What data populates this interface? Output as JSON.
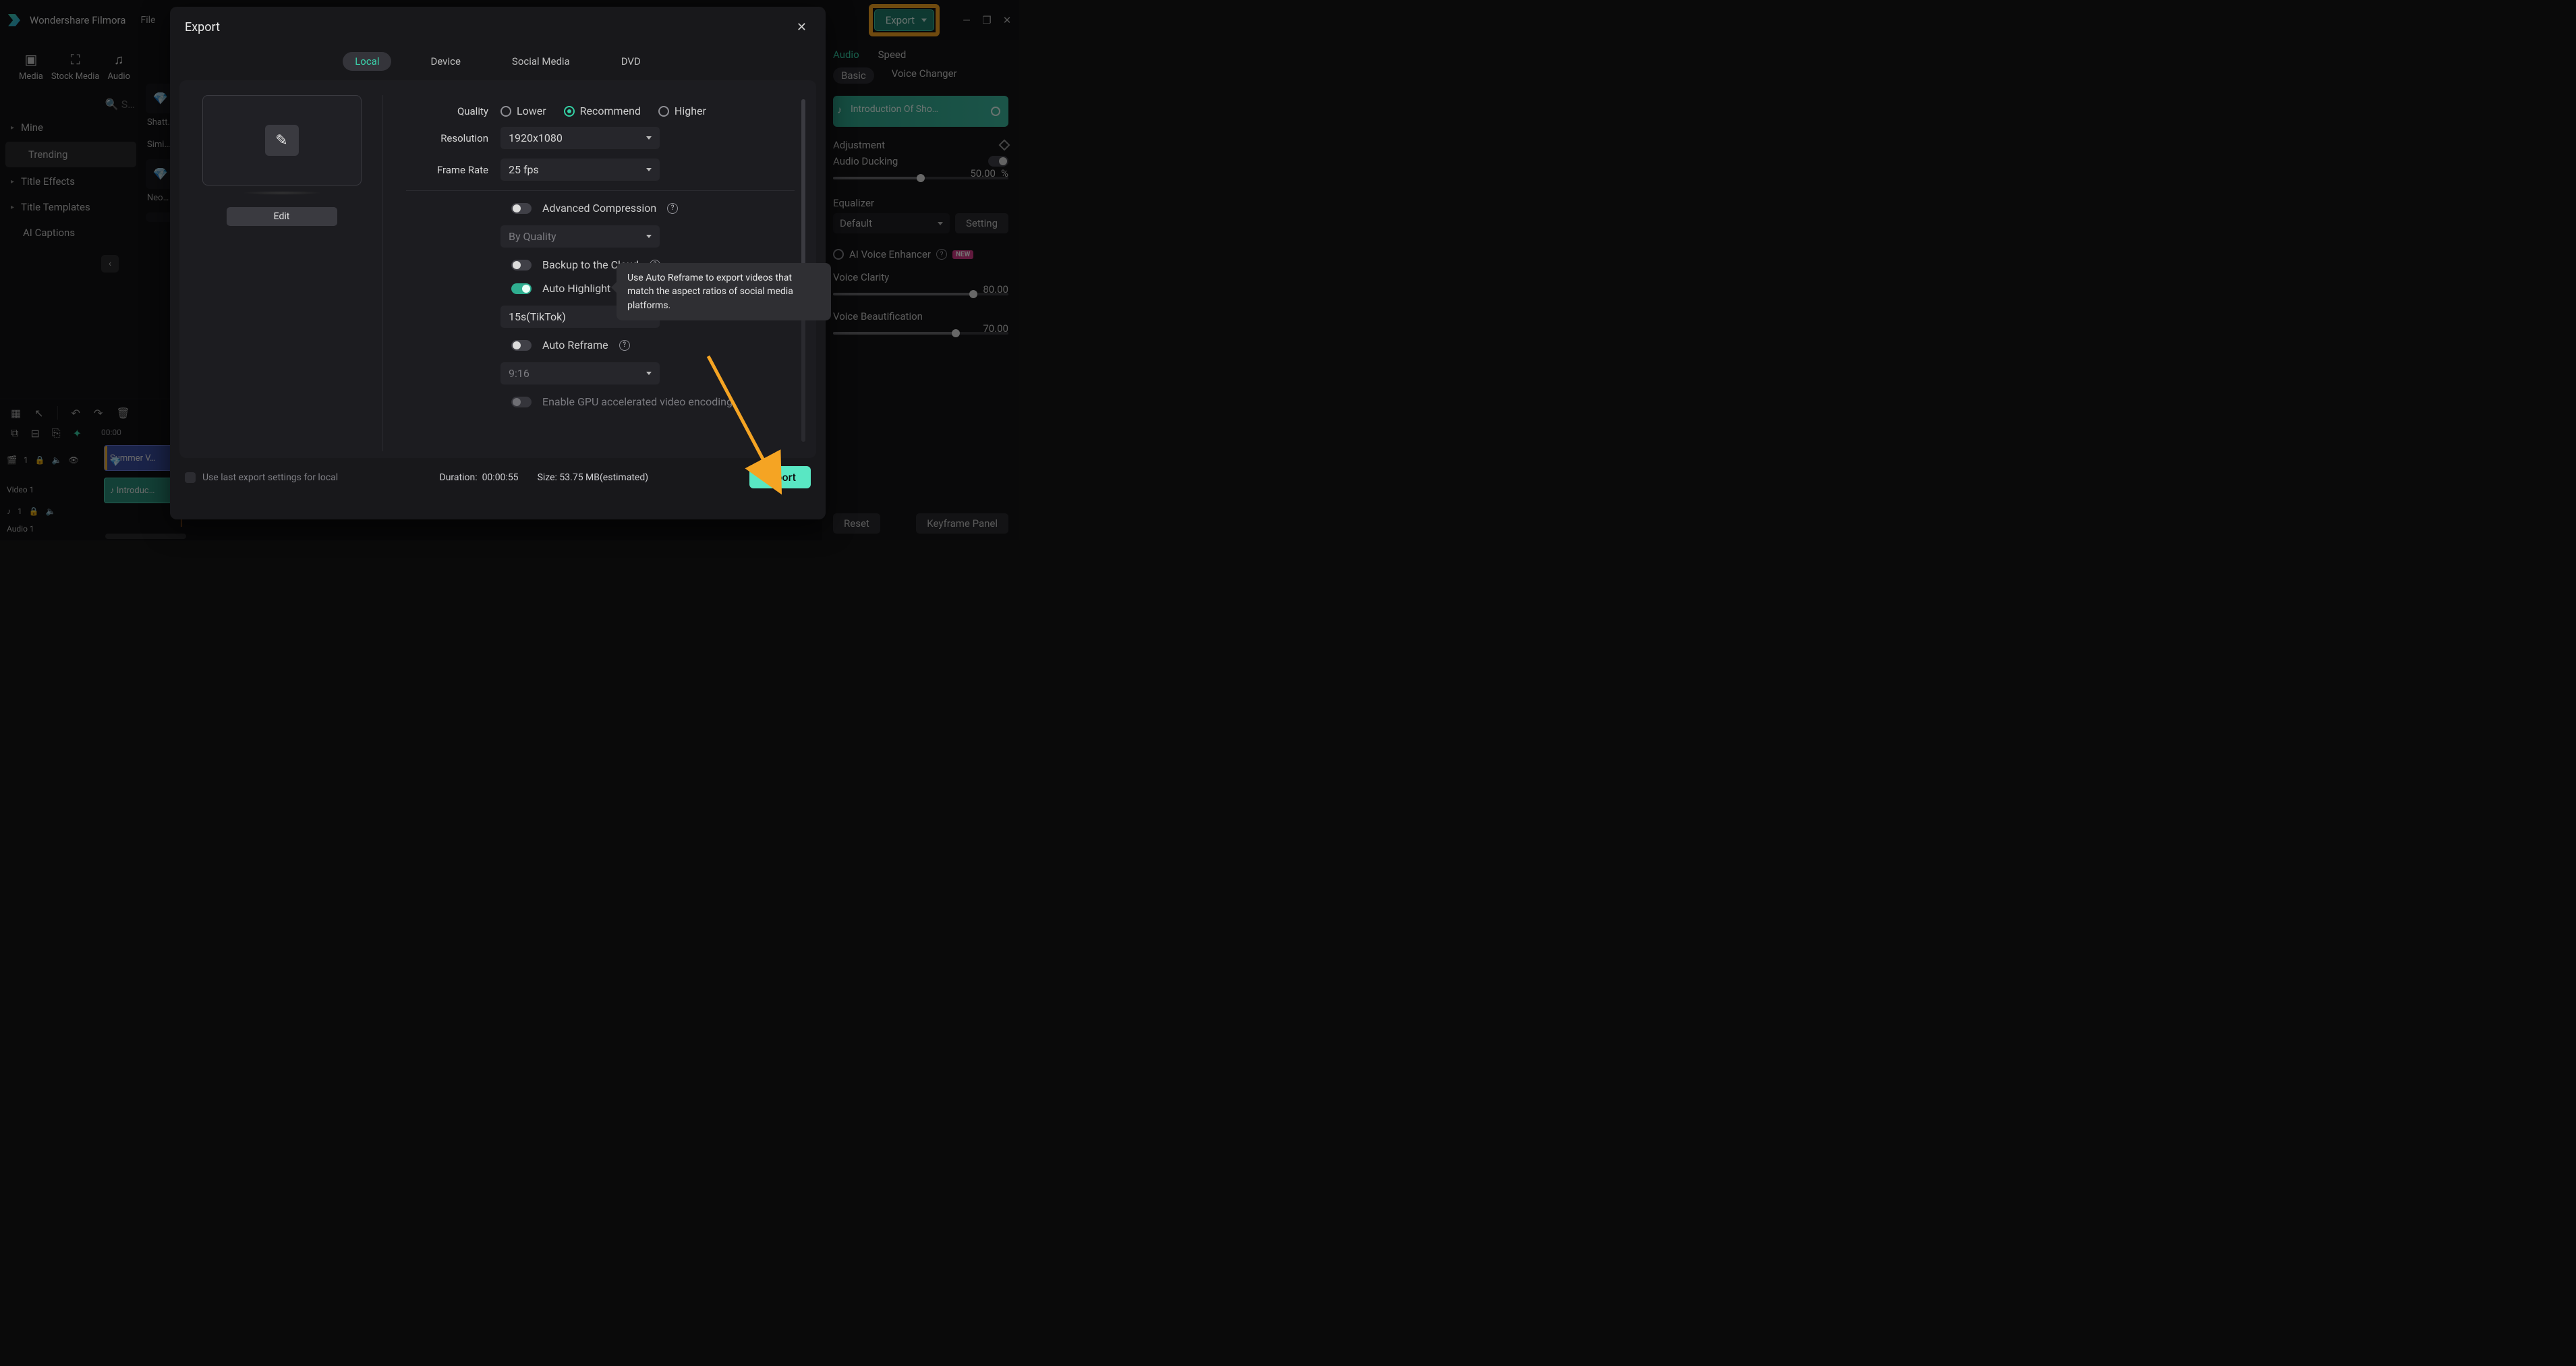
{
  "title": "Wondershare Filmora",
  "menu": {
    "file": "File"
  },
  "top_export_button": "Export",
  "mediabar": {
    "media": "Media",
    "stock": "Stock Media",
    "audio": "Audio"
  },
  "sidebar": {
    "mine": "Mine",
    "trending": "Trending",
    "title_effects": "Title Effects",
    "title_templates": "Title Templates",
    "ai_captions": "AI Captions"
  },
  "thumbs": {
    "shattered": "Shatt…",
    "simi": "Simi…",
    "neo": "Neo…"
  },
  "right": {
    "tabs": {
      "audio": "Audio",
      "speed": "Speed"
    },
    "subtabs": {
      "basic": "Basic",
      "voice": "Voice Changer"
    },
    "track_name": "Introduction Of Sho…",
    "adjustment": "Adjustment",
    "ducking": "Audio Ducking",
    "ducking_val": "50.00",
    "pct": "%",
    "equalizer": "Equalizer",
    "eq_default": "Default",
    "setting": "Setting",
    "ai_voice": "AI Voice Enhancer",
    "clarity": "Voice Clarity",
    "clarity_val": "80.00",
    "beaut": "Voice Beautification",
    "beaut_val": "70.00",
    "reset": "Reset",
    "keyframe": "Keyframe Panel",
    "new": "NEW"
  },
  "timeline": {
    "codes": [
      "00:00",
      "00"
    ],
    "video_track": "Video 1",
    "audio_track": "Audio 1",
    "v_num": "1",
    "a_num": "1",
    "clip_video": "Summer V…",
    "clip_audio": "Introduc…"
  },
  "modal": {
    "title": "Export",
    "tabs": {
      "local": "Local",
      "device": "Device",
      "social": "Social Media",
      "dvd": "DVD"
    },
    "edit": "Edit",
    "quality_label": "Quality",
    "quality": {
      "lower": "Lower",
      "recommend": "Recommend",
      "higher": "Higher"
    },
    "resolution_label": "Resolution",
    "resolution": "1920x1080",
    "framerate_label": "Frame Rate",
    "framerate": "25 fps",
    "adv_compression": "Advanced Compression",
    "by_quality": "By Quality",
    "backup": "Backup to the Cloud",
    "auto_highlight": "Auto Highlight",
    "auto_hl_preset": "15s(TikTok)",
    "auto_reframe": "Auto Reframe",
    "auto_reframe_ratio": "9:16",
    "gpu": "Enable GPU accelerated video encoding",
    "use_last": "Use last export settings for local",
    "duration_label": "Duration:",
    "duration": "00:00:55",
    "size_label": "Size:",
    "size": "53.75 MB(estimated)",
    "export": "Export"
  },
  "tooltip": "Use Auto Reframe to export videos that match the aspect ratios of social media platforms."
}
